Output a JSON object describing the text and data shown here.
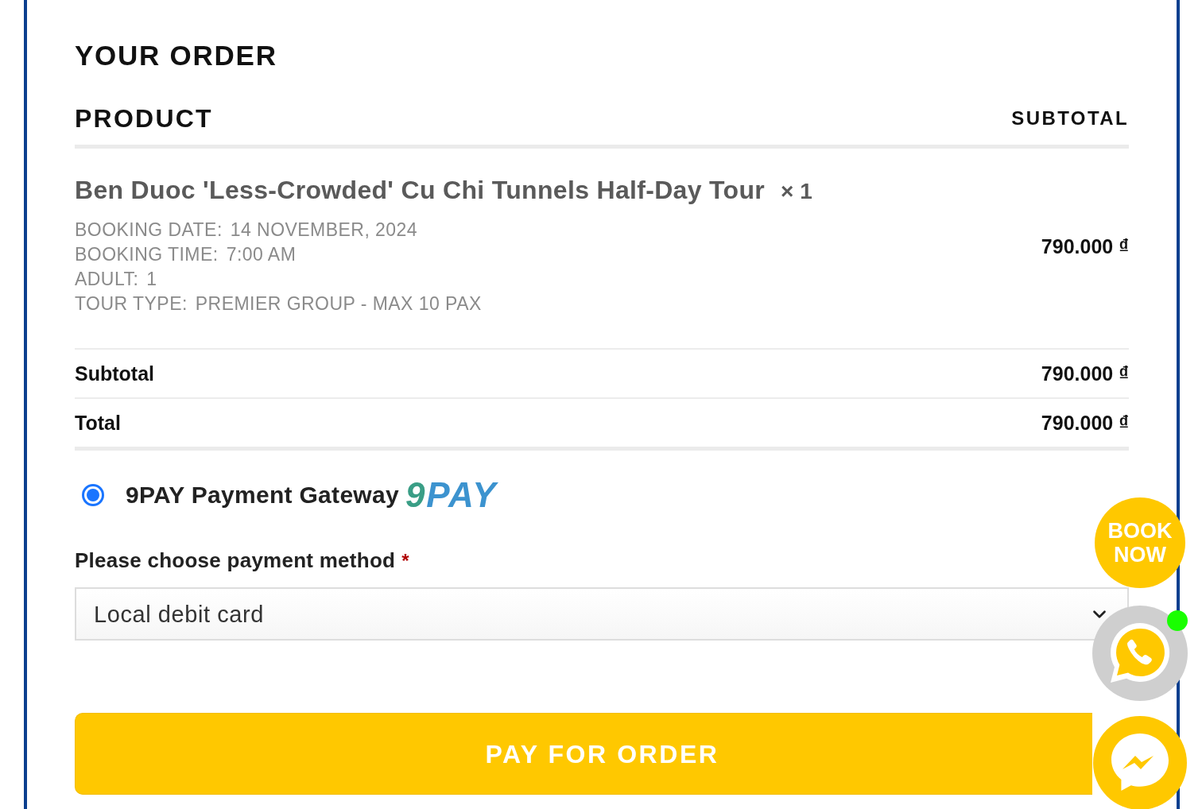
{
  "heading": "YOUR ORDER",
  "table": {
    "columns": [
      "PRODUCT",
      "SUBTOTAL"
    ],
    "items": [
      {
        "name": "Ben Duoc 'Less-Crowded' Cu Chi Tunnels Half-Day Tour",
        "quantity": "× 1",
        "meta": [
          {
            "label": "BOOKING DATE:",
            "value": "14 NOVEMBER, 2024"
          },
          {
            "label": "BOOKING TIME:",
            "value": "7:00 AM"
          },
          {
            "label": "ADULT:",
            "value": "1"
          },
          {
            "label": "TOUR TYPE:",
            "value": "PREMIER GROUP - MAX 10 PAX"
          }
        ],
        "subtotal": "790.000 ₫"
      }
    ],
    "totals": [
      {
        "label": "Subtotal",
        "value": "790.000 ₫"
      },
      {
        "label": "Total",
        "value": "790.000 ₫"
      }
    ]
  },
  "payment_methods": [
    {
      "label": "9PAY Payment Gateway",
      "selected": true,
      "logo_mark": "9",
      "logo_text": "PAY"
    }
  ],
  "method_field": {
    "label": "Please choose payment method",
    "required_mark": "*",
    "value": "Local debit card"
  },
  "pay_button": "PAY FOR ORDER",
  "floating": {
    "book_now": "BOOK NOW",
    "whatsapp_online": true
  }
}
